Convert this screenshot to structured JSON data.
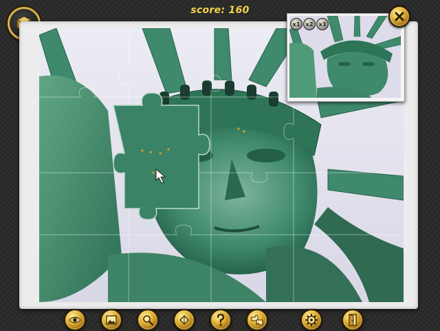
{
  "hud": {
    "score_text": "score: 160"
  },
  "menu_button": {
    "icon": "puzzle-box-icon"
  },
  "preview": {
    "zoom_buttons": [
      {
        "icon": "zoom-x1-icon"
      },
      {
        "icon": "zoom-x2-icon"
      },
      {
        "icon": "zoom-x3-icon"
      }
    ]
  },
  "close_button": {
    "icon": "close-icon"
  },
  "toolbar": {
    "buttons": [
      {
        "name": "show-image-button",
        "icon": "eye-icon"
      },
      {
        "name": "background-button",
        "icon": "picture-icon"
      },
      {
        "name": "magnifier-button",
        "icon": "magnifier-icon"
      },
      {
        "name": "edge-pieces-button",
        "icon": "edge-piece-icon"
      },
      {
        "name": "hint-button",
        "icon": "question-icon"
      },
      {
        "name": "sort-pieces-button",
        "icon": "pieces-icon"
      },
      {
        "name": "settings-button",
        "icon": "gear-icon"
      },
      {
        "name": "exit-button",
        "icon": "exit-door-icon"
      }
    ]
  },
  "colors": {
    "score": "#f2d34a",
    "statue": "#3f8a6c",
    "sky": "#e6e4ef",
    "gold": "#e6b93a"
  }
}
